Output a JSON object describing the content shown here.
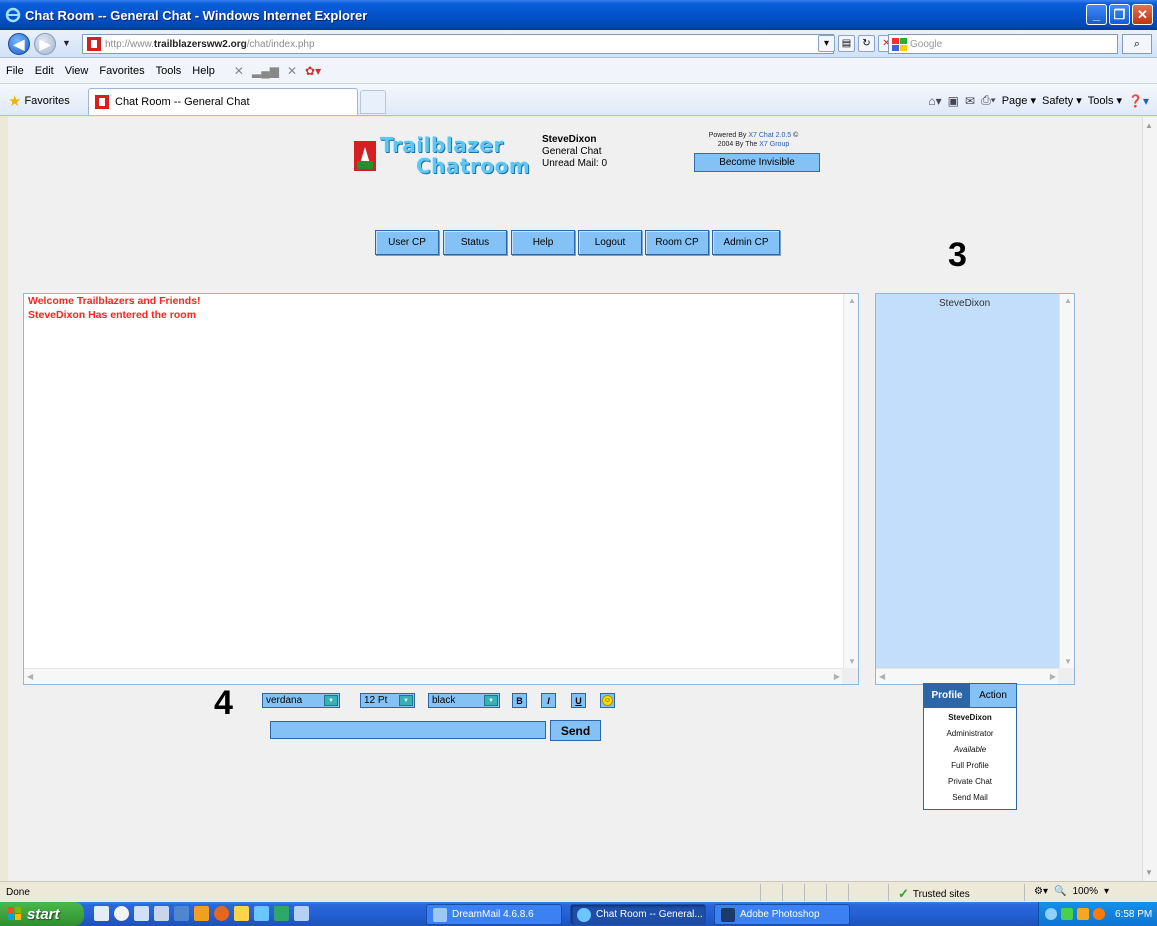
{
  "window": {
    "title": "Chat Room -- General Chat - Windows Internet Explorer",
    "url_prefix": "http://www.",
    "url_domain": "trailblazersww2.org",
    "url_path": "/chat/index.php",
    "search_placeholder": "Google"
  },
  "menu": [
    "File",
    "Edit",
    "View",
    "Favorites",
    "Tools",
    "Help"
  ],
  "favorites_label": "Favorites",
  "tab_title": "Chat Room -- General Chat",
  "command_bar": [
    "Page",
    "Safety",
    "Tools"
  ],
  "logo": {
    "line1": "Trailblazer",
    "line2": "Chatroom"
  },
  "user_info": {
    "username": "SteveDixon",
    "room": "General Chat",
    "unread": "Unread Mail: 0"
  },
  "powered": {
    "line1_prefix": "Powered By ",
    "line1_link": "X7 Chat 2.0.5",
    "line1_suffix": " ©",
    "line2_prefix": "2004 By The ",
    "line2_link": "X7 Group"
  },
  "invisible_button": "Become Invisible",
  "cp_buttons": [
    "User CP",
    "Status",
    "Help",
    "Logout",
    "Room CP",
    "Admin CP"
  ],
  "annotations": {
    "users_number": "3",
    "toolbar_number": "4"
  },
  "messages": [
    "Welcome Trailblazers and Friends!",
    "SteveDixon Has entered the room"
  ],
  "online_users": [
    "SteveDixon"
  ],
  "format_toolbar": {
    "font": "verdana",
    "size": "12 Pt",
    "color": "black",
    "bold": "B",
    "italic": "I",
    "underline": "U"
  },
  "send_label": "Send",
  "profile_panel": {
    "tabs": [
      "Profile",
      "Action"
    ],
    "active_tab": "Profile",
    "username": "SteveDixon",
    "role": "Administrator",
    "status": "Available",
    "links": [
      "Full Profile",
      "Private Chat",
      "Send Mail"
    ]
  },
  "status_bar": {
    "status": "Done",
    "zone": "Trusted sites",
    "zoom": "100%"
  },
  "taskbar": {
    "start": "start",
    "tasks": [
      "DreamMail 4.6.8.6",
      "Chat Room -- General...",
      "Adobe Photoshop"
    ],
    "clock": "6:58 PM"
  },
  "colors": {
    "accent_blue": "#84c2f5",
    "border_blue": "#2b66a9",
    "userlist_bg": "#c3defa",
    "message_red": "#ff2222"
  }
}
